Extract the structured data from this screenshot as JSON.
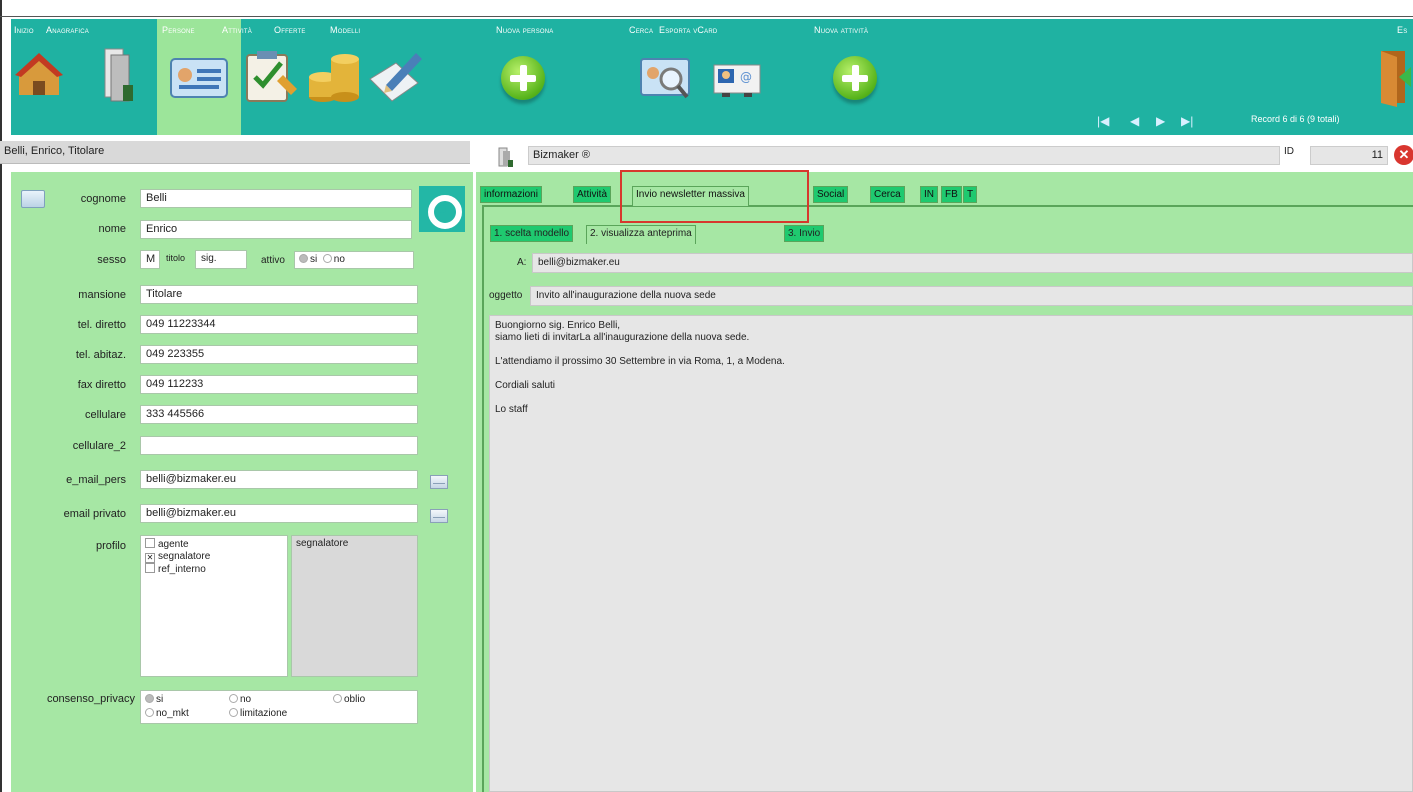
{
  "menu": {
    "inizio": "Inizio",
    "anagrafica": "Anagrafica",
    "persone": "Persone",
    "attivita": "Attività",
    "offerte": "Offerte",
    "modelli": "Modelli",
    "nuova_persona": "Nuova persona",
    "cerca": "Cerca",
    "esporta_vcard": "Esporta vCard",
    "nuova_attivita": "Nuova attività",
    "esci": "Es"
  },
  "nav": {
    "first": "|◀",
    "prev": "◀",
    "next": "▶",
    "last": "▶|",
    "record": "Record 6 di 6 (9 totali)"
  },
  "header": {
    "name": "Belli, Enrico, Titolare",
    "company": "Bizmaker ®",
    "id_label": "ID",
    "id_value": "11"
  },
  "fields": {
    "cognome_label": "cognome",
    "cognome": "Belli",
    "nome_label": "nome",
    "nome": "Enrico",
    "sesso_label": "sesso",
    "sesso": "M",
    "titolo_label": "titolo",
    "titolo": "sig.",
    "attivo_label": "attivo",
    "attivo_si": "si",
    "attivo_no": "no",
    "mansione_label": "mansione",
    "mansione": "Titolare",
    "tel_diretto_label": "tel. diretto",
    "tel_diretto": "049 11223344",
    "tel_abitaz_label": "tel. abitaz.",
    "tel_abitaz": "049 223355",
    "fax_diretto_label": "fax diretto",
    "fax_diretto": "049 112233",
    "cellulare_label": "cellulare",
    "cellulare": "333 445566",
    "cellulare_2_label": "cellulare_2",
    "cellulare_2": "",
    "email_pers_label": "e_mail_pers",
    "email_pers": "belli@bizmaker.eu",
    "email_privato_label": "email privato",
    "email_privato": "belli@bizmaker.eu",
    "profilo_label": "profilo",
    "profilo_options": [
      "agente",
      "segnalatore",
      "ref_interno"
    ],
    "profilo_value": "segnalatore",
    "privacy_label": "consenso_privacy",
    "privacy_options": [
      "si",
      "no",
      "oblio",
      "no_mkt",
      "limitazione"
    ]
  },
  "tabs": [
    "informazioni",
    "Attività",
    "Invio newsletter massiva",
    "Social",
    "Cerca",
    "IN",
    "FB",
    "T"
  ],
  "subtabs": [
    "1. scelta modello",
    "2. visualizza anteprima",
    "3. Invio"
  ],
  "email": {
    "to_label": "A:",
    "to": "belli@bizmaker.eu",
    "subject_label": "oggetto",
    "subject": "Invito all'inaugurazione della nuova sede",
    "body": [
      "Buongiorno sig. Enrico Belli,",
      "siamo lieti di invitarLa all'inaugurazione della nuova sede.",
      "",
      "L'attendiamo il prossimo 30 Settembre in via Roma, 1, a Modena.",
      "",
      "Cordiali saluti",
      "",
      "Lo staff"
    ]
  },
  "colors": {
    "toolbar": "#1fb2a2",
    "panel": "#a6e7a4",
    "tab": "#1fc96f",
    "highlight": "#d7372d"
  }
}
